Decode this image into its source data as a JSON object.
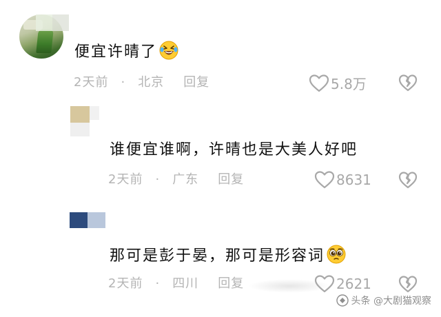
{
  "comments": [
    {
      "text": "便宜许晴了",
      "time": "2天前",
      "separator": "·",
      "location": "北京",
      "reply_label": "回复",
      "likes": "5.8万",
      "emoji": "rolling-on-floor-laughing-emoji"
    },
    {
      "text": "谁便宜谁啊，许晴也是大美人好吧",
      "time": "2天前",
      "separator": "·",
      "location": "广东",
      "reply_label": "回复",
      "likes": "8631"
    },
    {
      "text": "那可是彭于晏，那可是形容词",
      "time": "2天前",
      "separator": "·",
      "location": "四川",
      "reply_label": "回复",
      "likes": "2621",
      "emoji": "pleading-face-emoji"
    }
  ],
  "watermark": {
    "text": "头条 @大剧猫观察"
  },
  "colors": {
    "text": "#111111",
    "meta": "#b4b4b4",
    "icon": "#a8a8a8"
  }
}
